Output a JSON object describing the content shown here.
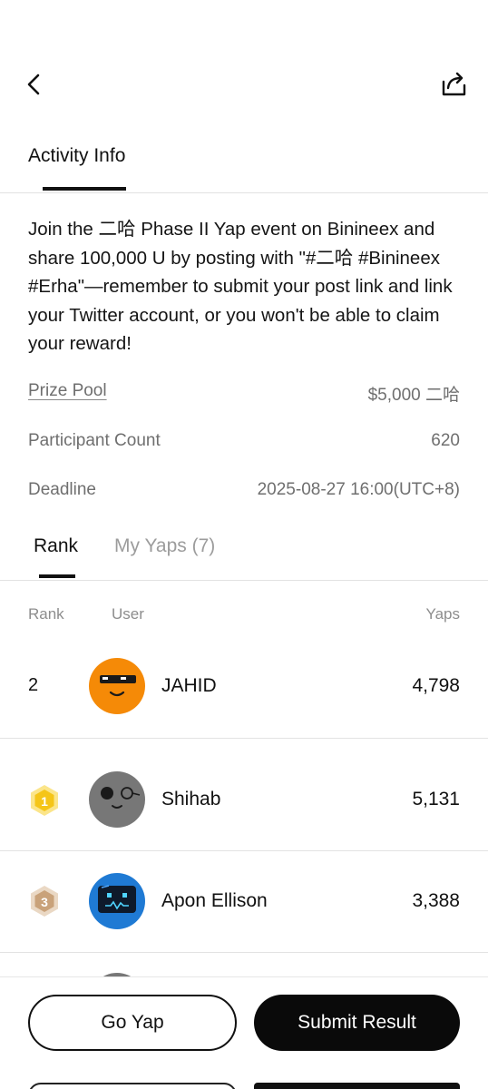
{
  "header": {
    "back_icon": "chevron-left-icon",
    "share_icon": "share-icon"
  },
  "tabs": {
    "activity_info": "Activity Info"
  },
  "description": "Join the 二哈 Phase II Yap event on Binineex and share 100,000 U by posting with \"#二哈 #Binineex #Erha\"—remember to submit your post link and link your Twitter account, or you won't be able to claim your reward!",
  "info": {
    "prize_pool_label": "Prize Pool",
    "prize_pool_value": "$5,000 二哈",
    "participant_label": "Participant Count",
    "participant_value": "620",
    "deadline_label": "Deadline",
    "deadline_value": "2025-08-27 16:00(UTC+8)"
  },
  "rank_tabs": {
    "rank": "Rank",
    "my_yaps": "My Yaps (7)"
  },
  "table": {
    "headers": {
      "rank": "Rank",
      "user": "User",
      "yaps": "Yaps"
    },
    "rows": [
      {
        "rank": "2",
        "badge": null,
        "user": "JAHID",
        "yaps": "4,798",
        "avatar_color": "#f58a07"
      },
      {
        "rank": "1",
        "badge": "gold-medal-icon",
        "user": "Shihab",
        "yaps": "5,131",
        "avatar_color": "#7a7a7a"
      },
      {
        "rank": "3",
        "badge": "bronze-medal-icon",
        "user": "Apon Ellison",
        "yaps": "3,388",
        "avatar_color": "#1f7ad4"
      }
    ]
  },
  "buttons": {
    "go_yap": "Go Yap",
    "submit_result": "Submit Result"
  },
  "colors": {
    "primary": "#0a0a0a",
    "muted": "#6f6f6f",
    "gold": "#f5c518",
    "bronze": "#c9a27a"
  }
}
